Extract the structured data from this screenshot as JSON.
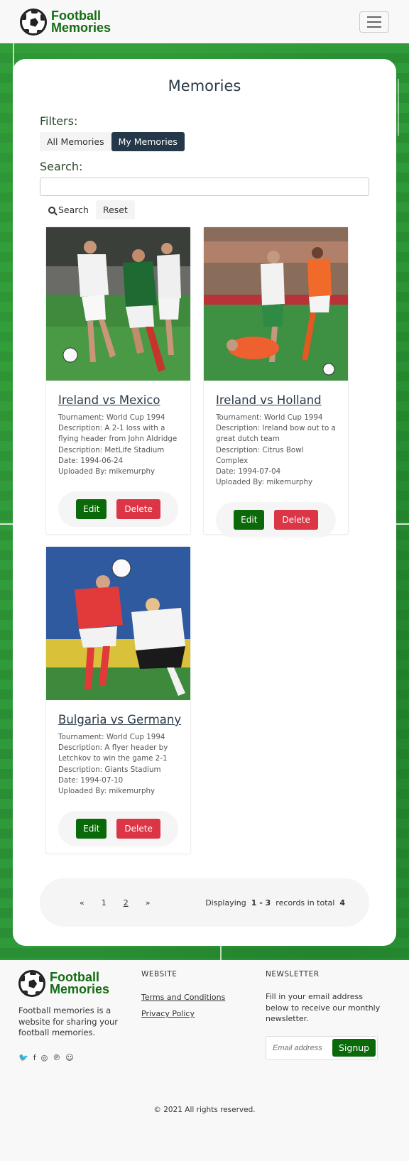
{
  "brand": {
    "line1": "Football",
    "line2": "Memories"
  },
  "page": {
    "title": "Memories"
  },
  "filters": {
    "label": "Filters:",
    "all_label": "All Memories",
    "mine_label": "My Memories",
    "active": "My Memories"
  },
  "search": {
    "label": "Search:",
    "value": "",
    "search_button": "Search",
    "reset_button": "Reset"
  },
  "memories": [
    {
      "title": "Ireland vs Mexico",
      "tournament": "Tournament: World Cup 1994",
      "description": "Description: A 2-1 loss with a flying header from John Aldridge",
      "venue": "Description: MetLife Stadium",
      "date": "Date: 1994-06-24",
      "uploaded_by": "Uploaded By: mikemurphy",
      "edit_label": "Edit",
      "delete_label": "Delete"
    },
    {
      "title": "Ireland vs Holland",
      "tournament": "Tournament: World Cup 1994",
      "description": "Description: Ireland bow out to a great dutch team",
      "venue": "Description: Citrus Bowl Complex",
      "date": "Date: 1994-07-04",
      "uploaded_by": "Uploaded By: mikemurphy",
      "edit_label": "Edit",
      "delete_label": "Delete"
    },
    {
      "title": "Bulgaria vs Germany",
      "tournament": "Tournament: World Cup 1994",
      "description": "Description: A flyer header by Letchkov to win the game 2-1",
      "venue": "Description: Giants Stadium",
      "date": "Date: 1994-07-10",
      "uploaded_by": "Uploaded By: mikemurphy",
      "edit_label": "Edit",
      "delete_label": "Delete"
    }
  ],
  "pagination": {
    "prev": "«",
    "pages": [
      "1",
      "2"
    ],
    "current": "2",
    "next": "»",
    "displaying_prefix": "Displaying",
    "range": "1 - 3",
    "records_text": "records in total",
    "total": "4"
  },
  "footer": {
    "description": "Football memories is a website for sharing your football memories.",
    "social_icons": [
      "twitter-icon",
      "facebook-icon",
      "instagram-icon",
      "pinterest-icon",
      "snapchat-icon"
    ],
    "website_heading": "WEBSITE",
    "links": [
      "Terms and Conditions",
      "Privacy Policy"
    ],
    "newsletter_heading": "NEWSLETTER",
    "newsletter_text": "Fill in your email address below to receive our monthly newsletter.",
    "email_placeholder": "Email address",
    "signup_label": "Signup",
    "copyright": "© 2021 All rights reserved."
  },
  "colors": {
    "brand_green": "#146c14",
    "button_green": "#0a6a0a",
    "delete_red": "#dc3545",
    "active_filter": "#24384a"
  }
}
